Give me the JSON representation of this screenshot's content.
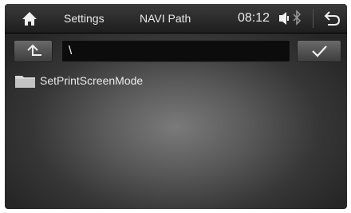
{
  "statusbar": {
    "home_icon": "home-icon",
    "settings_label": "Settings",
    "path_title": "NAVI Path",
    "clock": "08:12",
    "volume_icon": "volume-icon",
    "bluetooth_icon": "bluetooth-icon",
    "back_icon": "back-arrow-icon"
  },
  "toolbar": {
    "up_icon": "up-folder-icon",
    "path_value": "\\",
    "confirm_icon": "checkmark-icon"
  },
  "files": [
    {
      "icon": "folder-icon",
      "name": "SetPrintScreenMode"
    }
  ]
}
